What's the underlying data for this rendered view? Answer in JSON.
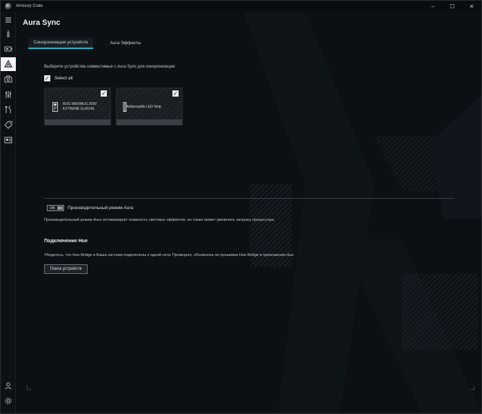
{
  "window": {
    "title": "Armoury Crate",
    "controls": {
      "minimize": "–",
      "maximize": "☐",
      "close": "✕"
    }
  },
  "sidebar": {
    "items": [
      {
        "icon": "menu-icon"
      },
      {
        "icon": "info-icon"
      },
      {
        "icon": "device-icon"
      },
      {
        "icon": "aura-icon",
        "active": true
      },
      {
        "icon": "gamevisual-icon"
      },
      {
        "icon": "sliders-icon"
      },
      {
        "icon": "tools-icon"
      },
      {
        "icon": "tag-icon"
      },
      {
        "icon": "id-card-icon"
      },
      {
        "icon": "user-icon"
      },
      {
        "icon": "settings-icon"
      }
    ]
  },
  "page": {
    "title": "Aura Sync"
  },
  "tabs": [
    {
      "label": "Синхронизация устройств",
      "active": true
    },
    {
      "label": "Aura Эффекты",
      "active": false
    }
  ],
  "sync": {
    "instruction": "Выберите устройства совместимые с Aura Sync для синхронизации",
    "select_all_label": "Select all",
    "select_all_checked": true,
    "devices": [
      {
        "name_line1": "ROG MAXIMUS Z690",
        "name_line2": "EXTREME GLACIAL",
        "checked": true
      },
      {
        "name_line1": "Addressable LED Strip",
        "name_line2": "",
        "checked": true
      }
    ]
  },
  "performance": {
    "toggle_state": "ON",
    "label": "Производительный режим Aura",
    "description": "Производительный режим Aura оптимизирует плавность световых эффектов, но также может увеличить загрузку процессора."
  },
  "hue": {
    "title": "Подключение Hue",
    "description": "Убедитесь, что Hue Bridge и Ваша система подключены к одной сети. Проверьте, обновлена ли прошивка Hue Bridge в приложении Hue.",
    "button_label": "Поиск устройств"
  },
  "colors": {
    "accent": "#29b6c9",
    "background": "#0c1014",
    "text": "#d7dbe0"
  }
}
